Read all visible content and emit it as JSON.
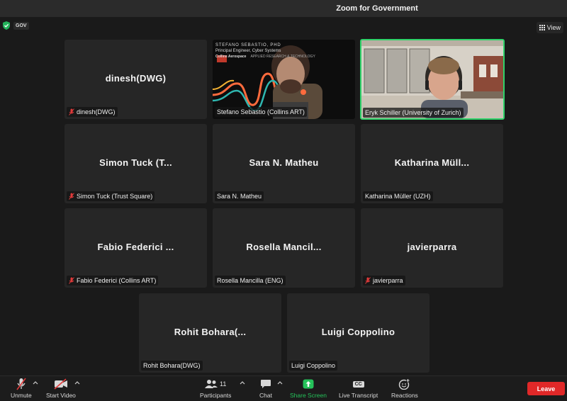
{
  "window": {
    "title": "Zoom for Government"
  },
  "badge": {
    "label": "GOV"
  },
  "view_button": {
    "label": "View"
  },
  "tiles": [
    {
      "display": "dinesh(DWG)",
      "name": "dinesh(DWG)",
      "muted": true
    },
    {
      "display": "",
      "name": "Stefano Sebastio (Collins ART)",
      "muted": false
    },
    {
      "display": "",
      "name": "Eryk Schiller (University of Zurich)",
      "muted": false
    },
    {
      "display": "Simon Tuck (T...",
      "name": "Simon Tuck (Trust Square)",
      "muted": true
    },
    {
      "display": "Sara N. Matheu",
      "name": "Sara N. Matheu",
      "muted": false
    },
    {
      "display": "Katharina Müll...",
      "name": "Katharina Müller (UZH)",
      "muted": false
    },
    {
      "display": "Fabio Federici ...",
      "name": "Fabio Federici (Collins ART)",
      "muted": true
    },
    {
      "display": "Rosella Mancil...",
      "name": "Rosella Mancilla (ENG)",
      "muted": false
    },
    {
      "display": "javierparra",
      "name": "javierparra",
      "muted": true
    },
    {
      "display": "Rohit Bohara(...",
      "name": "Rohit Bohara(DWG)",
      "muted": false
    },
    {
      "display": "Luigi Coppolino",
      "name": "Luigi Coppolino",
      "muted": false
    }
  ],
  "stefano_slide": {
    "line1": "STEFANO SEBASTIO, PHD",
    "line2": "Principal Engineer, Cyber Systems",
    "brand": "Collins Aerospace",
    "dept": "APPLIED RESEARCH & TECHNOLOGY"
  },
  "toolbar": {
    "unmute": "Unmute",
    "start_video": "Start Video",
    "participants": "Participants",
    "participants_count": "11",
    "chat": "Chat",
    "share_screen": "Share Screen",
    "live_transcript": "Live Transcript",
    "live_transcript_icon": "CC",
    "reactions": "Reactions",
    "leave": "Leave"
  },
  "colors": {
    "active_speaker": "#2fd36a",
    "leave": "#e02828",
    "share": "#25c25a"
  }
}
